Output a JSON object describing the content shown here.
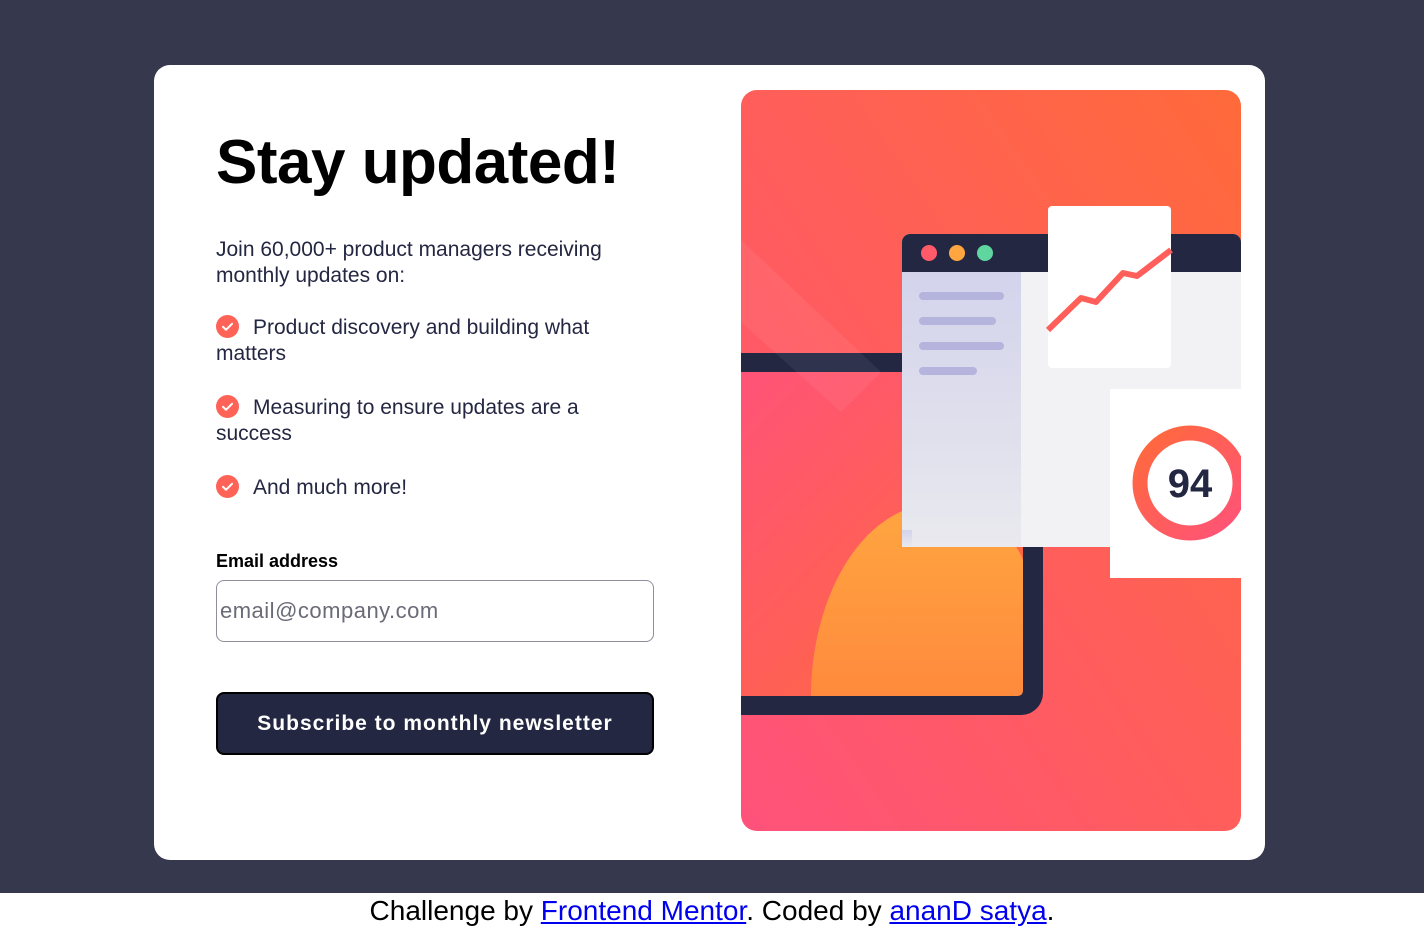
{
  "card": {
    "title": "Stay updated!",
    "intro": "Join 60,000+ product managers receiving monthly updates on:",
    "features": [
      "Product discovery and building what matters",
      "Measuring to ensure updates are a success",
      "And much more!"
    ],
    "email_label": "Email address",
    "email_placeholder": "email@company.com",
    "email_value": "",
    "submit_label": "Subscribe to monthly newsletter"
  },
  "illustration": {
    "score": "94"
  },
  "footer": {
    "prefix": "Challenge by ",
    "link1": "Frontend Mentor",
    "middle": ". Coded by ",
    "link2": "ananD satya",
    "suffix": "."
  },
  "colors": {
    "page_bg": "#36384d",
    "card_bg": "#ffffff",
    "accent": "#ff6257",
    "button_bg": "#242742",
    "text_dark": "#242742"
  },
  "icons": [
    "check-icon"
  ]
}
